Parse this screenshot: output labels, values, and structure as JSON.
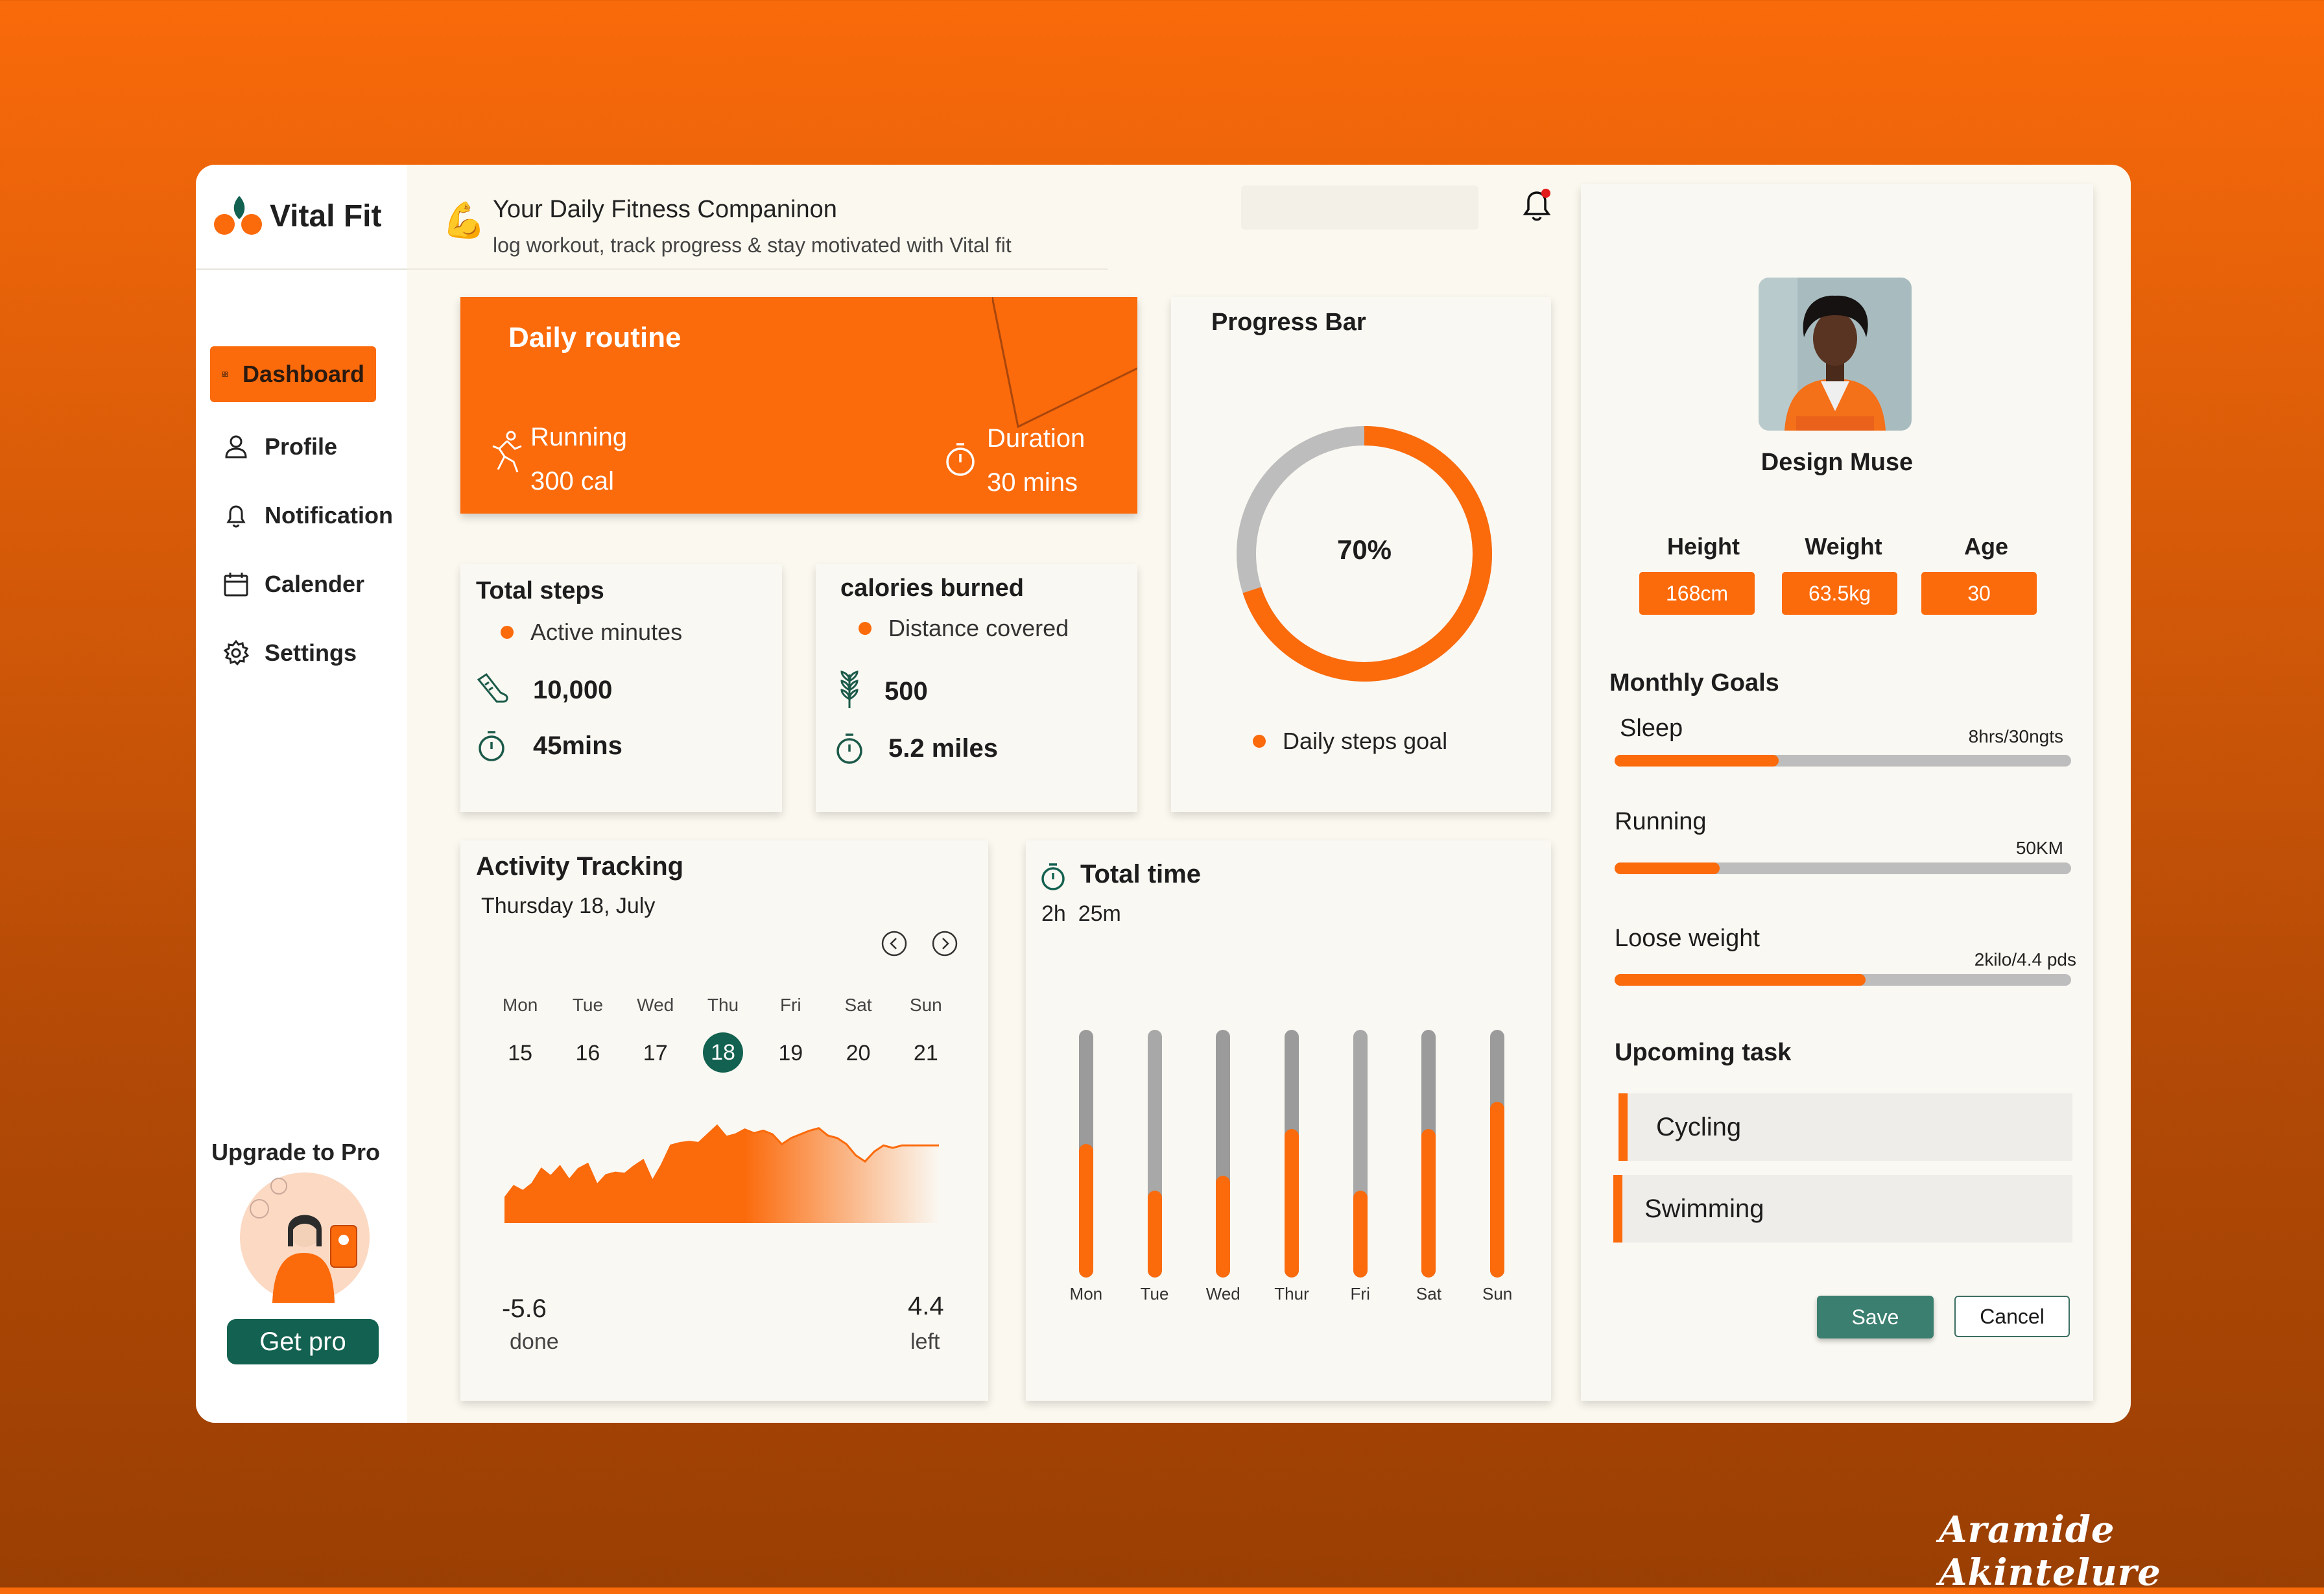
{
  "brand": {
    "name": "Vital Fit",
    "accent": "#fb6a0b",
    "green": "#136150"
  },
  "header": {
    "title": "Your Daily Fitness Companinon",
    "subtitle": "log workout, track progress & stay motivated with Vital fit",
    "title_icon": "flexed-biceps-emoji",
    "search_placeholder": ""
  },
  "nav": [
    {
      "label": "Dashboard",
      "icon": "dashboard-icon",
      "active": true
    },
    {
      "label": "Profile",
      "icon": "user-icon"
    },
    {
      "label": "Notification",
      "icon": "bell-icon"
    },
    {
      "label": "Calender",
      "icon": "calendar-icon"
    },
    {
      "label": "Settings",
      "icon": "gear-icon"
    }
  ],
  "upgrade": {
    "title": "Upgrade to Pro",
    "button": "Get pro"
  },
  "routine": {
    "title": "Daily routine",
    "activity_label": "Running",
    "activity_value": "300 cal",
    "duration_label": "Duration",
    "duration_value": "30 mins"
  },
  "steps_card": {
    "title": "Total steps",
    "legend": "Active minutes",
    "steps": "10,000",
    "minutes": "45mins"
  },
  "calories_card": {
    "title": "calories burned",
    "legend": "Distance covered",
    "calories": "500",
    "distance": "5.2 miles"
  },
  "progress": {
    "title": "Progress Bar",
    "percent": 70,
    "percent_label": "70%",
    "legend": "Daily steps goal"
  },
  "activity": {
    "title": "Activity Tracking",
    "date": "Thursday 18, July",
    "days": [
      {
        "name": "Mon",
        "num": "15"
      },
      {
        "name": "Tue",
        "num": "16"
      },
      {
        "name": "Wed",
        "num": "17"
      },
      {
        "name": "Thu",
        "num": "18",
        "selected": true
      },
      {
        "name": "Fri",
        "num": "19"
      },
      {
        "name": "Sat",
        "num": "20"
      },
      {
        "name": "Sun",
        "num": "21"
      }
    ],
    "done_value": "-5.6",
    "done_label": "done",
    "left_value": "4.4",
    "left_label": "left"
  },
  "total_time": {
    "title": "Total time",
    "value": "2h  25m"
  },
  "chart_data": [
    {
      "type": "area",
      "title": "",
      "x": [
        0,
        1,
        2,
        3,
        4,
        5,
        6,
        7,
        8,
        9,
        10,
        11,
        12,
        13,
        14,
        15,
        16,
        17,
        18,
        19,
        20,
        21,
        22,
        23,
        24,
        25,
        26,
        27,
        28,
        29,
        30,
        31,
        32,
        33,
        34,
        35,
        36,
        37,
        38,
        39,
        40,
        41,
        42,
        43,
        44,
        45,
        46,
        47
      ],
      "values": [
        2,
        3,
        2.6,
        3.2,
        4.4,
        3.8,
        4.6,
        3.5,
        4.4,
        4.8,
        3.1,
        3.9,
        4.1,
        4.0,
        4.6,
        5.1,
        3.4,
        4.7,
        6.3,
        6.5,
        6.6,
        6.5,
        7.2,
        7.9,
        7.0,
        7.2,
        7.6,
        7.3,
        7.5,
        7.2,
        6.4,
        6.9,
        7.2,
        7.5,
        7.7,
        7.1,
        6.9,
        6.4,
        5.5,
        5.0,
        5.8,
        6.3,
        6.1,
        6.3,
        6.3,
        6.3,
        6.3,
        6.3
      ],
      "ylim": [
        0,
        10
      ]
    },
    {
      "type": "bar",
      "title": "",
      "categories": [
        "Mon",
        "Tue",
        "Wed",
        "Thur",
        "Fri",
        "Sat",
        "Sun"
      ],
      "series": [
        {
          "values": [
            0.54,
            0.35,
            0.41,
            0.6,
            0.35,
            0.6,
            0.71
          ]
        }
      ],
      "ylim": [
        0,
        1
      ]
    }
  ],
  "profile": {
    "name": "Design Muse",
    "height_label": "Height",
    "height": "168cm",
    "weight_label": "Weight",
    "weight": "63.5kg",
    "age_label": "Age",
    "age": "30"
  },
  "goals": {
    "title": "Monthly Goals",
    "items": [
      {
        "label": "Sleep",
        "target": "8hrs/30ngts",
        "progress": 0.36
      },
      {
        "label": "Running",
        "target": "50KM",
        "progress": 0.23
      },
      {
        "label": "Loose weight",
        "target": "2kilo/4.4 pds",
        "progress": 0.55
      }
    ]
  },
  "tasks": {
    "title": "Upcoming task",
    "items": [
      "Cycling",
      "Swimming"
    ]
  },
  "actions": {
    "save": "Save",
    "cancel": "Cancel"
  },
  "signature": "Aramide Akintelure"
}
